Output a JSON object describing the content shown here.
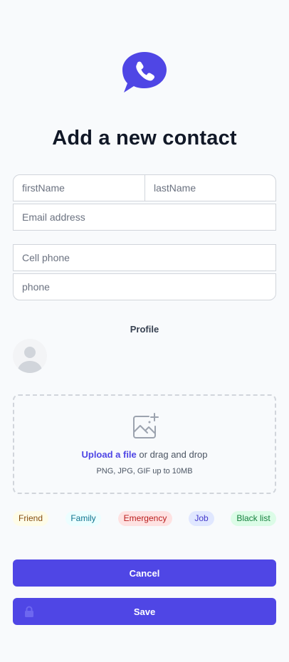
{
  "header": {
    "logo_icon": "phone-chat-bubble-icon",
    "brand_color": "#4f46e5",
    "title": "Add a new contact"
  },
  "form": {
    "first_name_placeholder": "firstName",
    "last_name_placeholder": "lastName",
    "email_placeholder": "Email address",
    "cell_phone_placeholder": "Cell phone",
    "phone_placeholder": "phone"
  },
  "profile": {
    "label": "Profile",
    "avatar_icon": "user-avatar-placeholder-icon"
  },
  "upload": {
    "icon": "image-add-icon",
    "link_text": "Upload a file",
    "rest_text": " or drag and drop",
    "hint": "PNG, JPG, GIF up to 10MB"
  },
  "tags": [
    {
      "label": "Friend",
      "bg": "#fefce8",
      "color": "#854d0e"
    },
    {
      "label": "Family",
      "bg": "#ecfeff",
      "color": "#0e7490"
    },
    {
      "label": "Emergency",
      "bg": "#fee2e2",
      "color": "#b91c1c"
    },
    {
      "label": "Job",
      "bg": "#e0e7ff",
      "color": "#4338ca"
    },
    {
      "label": "Black list",
      "bg": "#dcfce7",
      "color": "#15803d"
    }
  ],
  "actions": {
    "cancel_label": "Cancel",
    "save_label": "Save",
    "save_icon": "lock-icon"
  }
}
